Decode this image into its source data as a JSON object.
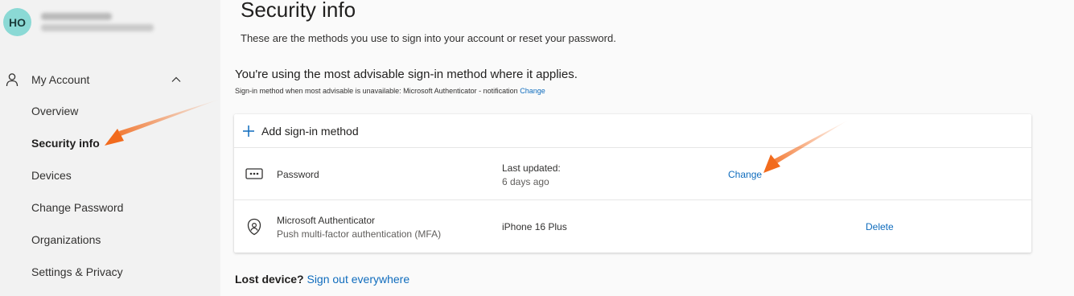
{
  "profile": {
    "initials": "HO"
  },
  "sidebar": {
    "group_label": "My Account",
    "items": [
      {
        "label": "Overview"
      },
      {
        "label": "Security info"
      },
      {
        "label": "Devices"
      },
      {
        "label": "Change Password"
      },
      {
        "label": "Organizations"
      },
      {
        "label": "Settings & Privacy"
      }
    ]
  },
  "main": {
    "title": "Security info",
    "description": "These are the methods you use to sign into your account or reset your password.",
    "advisable": "You're using the most advisable sign-in method where it applies.",
    "advisable_sub": "Sign-in method when most advisable is unavailable: Microsoft Authenticator - notification",
    "advisable_change": "Change",
    "add_method": "Add sign-in method",
    "methods": [
      {
        "name": "Password",
        "detail_label": "Last updated:",
        "detail_value": "6 days ago",
        "action": "Change"
      },
      {
        "name": "Microsoft Authenticator",
        "sub": "Push multi-factor authentication (MFA)",
        "detail_label": "iPhone 16 Plus",
        "action": "Delete"
      }
    ],
    "lost_label": "Lost device?",
    "lost_link": "Sign out everywhere"
  },
  "colors": {
    "accent": "#0f6cbd",
    "avatar": "#8bd9d5",
    "arrow": "#f26b1d"
  }
}
